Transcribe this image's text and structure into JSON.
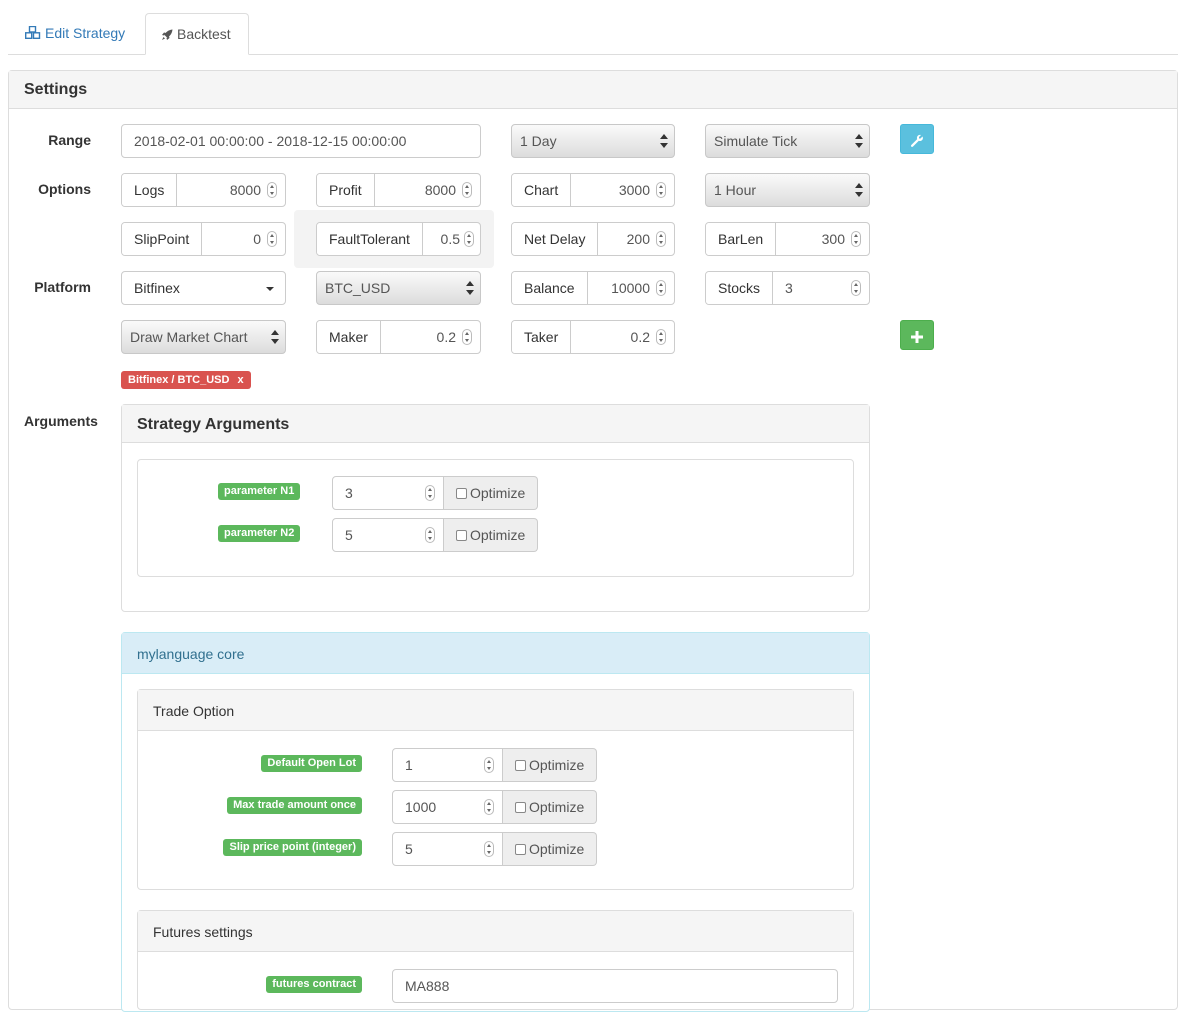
{
  "tabs": [
    {
      "label": "Edit Strategy",
      "icon": "cubes-icon"
    },
    {
      "label": "Backtest",
      "icon": "rocket-icon"
    }
  ],
  "settings": {
    "title": "Settings",
    "range": {
      "label": "Range",
      "date_range": "2018-02-01 00:00:00 - 2018-12-15 00:00:00",
      "period": "1 Day",
      "mode": "Simulate Tick"
    },
    "options": {
      "label": "Options",
      "logs": {
        "label": "Logs",
        "value": "8000"
      },
      "profit": {
        "label": "Profit",
        "value": "8000"
      },
      "chart": {
        "label": "Chart",
        "value": "3000"
      },
      "period": "1 Hour",
      "slippoint": {
        "label": "SlipPoint",
        "value": "0"
      },
      "fault_tolerant": {
        "label": "FaultTolerant",
        "value": "0.5"
      },
      "net_delay": {
        "label": "Net Delay",
        "value": "200"
      },
      "barlen": {
        "label": "BarLen",
        "value": "300"
      }
    },
    "platform": {
      "label": "Platform",
      "exchange": "Bitfinex",
      "pair": "BTC_USD",
      "balance": {
        "label": "Balance",
        "value": "10000"
      },
      "stocks": {
        "label": "Stocks",
        "value": "3"
      },
      "draw_mode": "Draw Market Chart",
      "maker": {
        "label": "Maker",
        "value": "0.2"
      },
      "taker": {
        "label": "Taker",
        "value": "0.2"
      },
      "tag": "Bitfinex / BTC_USD",
      "tag_remove": "x"
    },
    "arguments": {
      "label": "Arguments",
      "strategy_title": "Strategy Arguments",
      "params": [
        {
          "label": "parameter N1",
          "value": "3",
          "optimize": "Optimize"
        },
        {
          "label": "parameter N2",
          "value": "5",
          "optimize": "Optimize"
        }
      ],
      "core_title": "mylanguage core",
      "trade_option": {
        "title": "Trade Option",
        "params": [
          {
            "label": "Default Open Lot",
            "value": "1",
            "optimize": "Optimize"
          },
          {
            "label": "Max trade amount once",
            "value": "1000",
            "optimize": "Optimize"
          },
          {
            "label": "Slip price point (integer)",
            "value": "5",
            "optimize": "Optimize"
          }
        ]
      },
      "futures": {
        "title": "Futures settings",
        "contract_label": "futures contract",
        "contract_value": "MA888"
      }
    }
  },
  "colors": {
    "link": "#337ab7",
    "info_button": "#5bc0de",
    "success": "#5cb85c",
    "danger": "#d9534f",
    "info_panel": "#d9edf7"
  }
}
